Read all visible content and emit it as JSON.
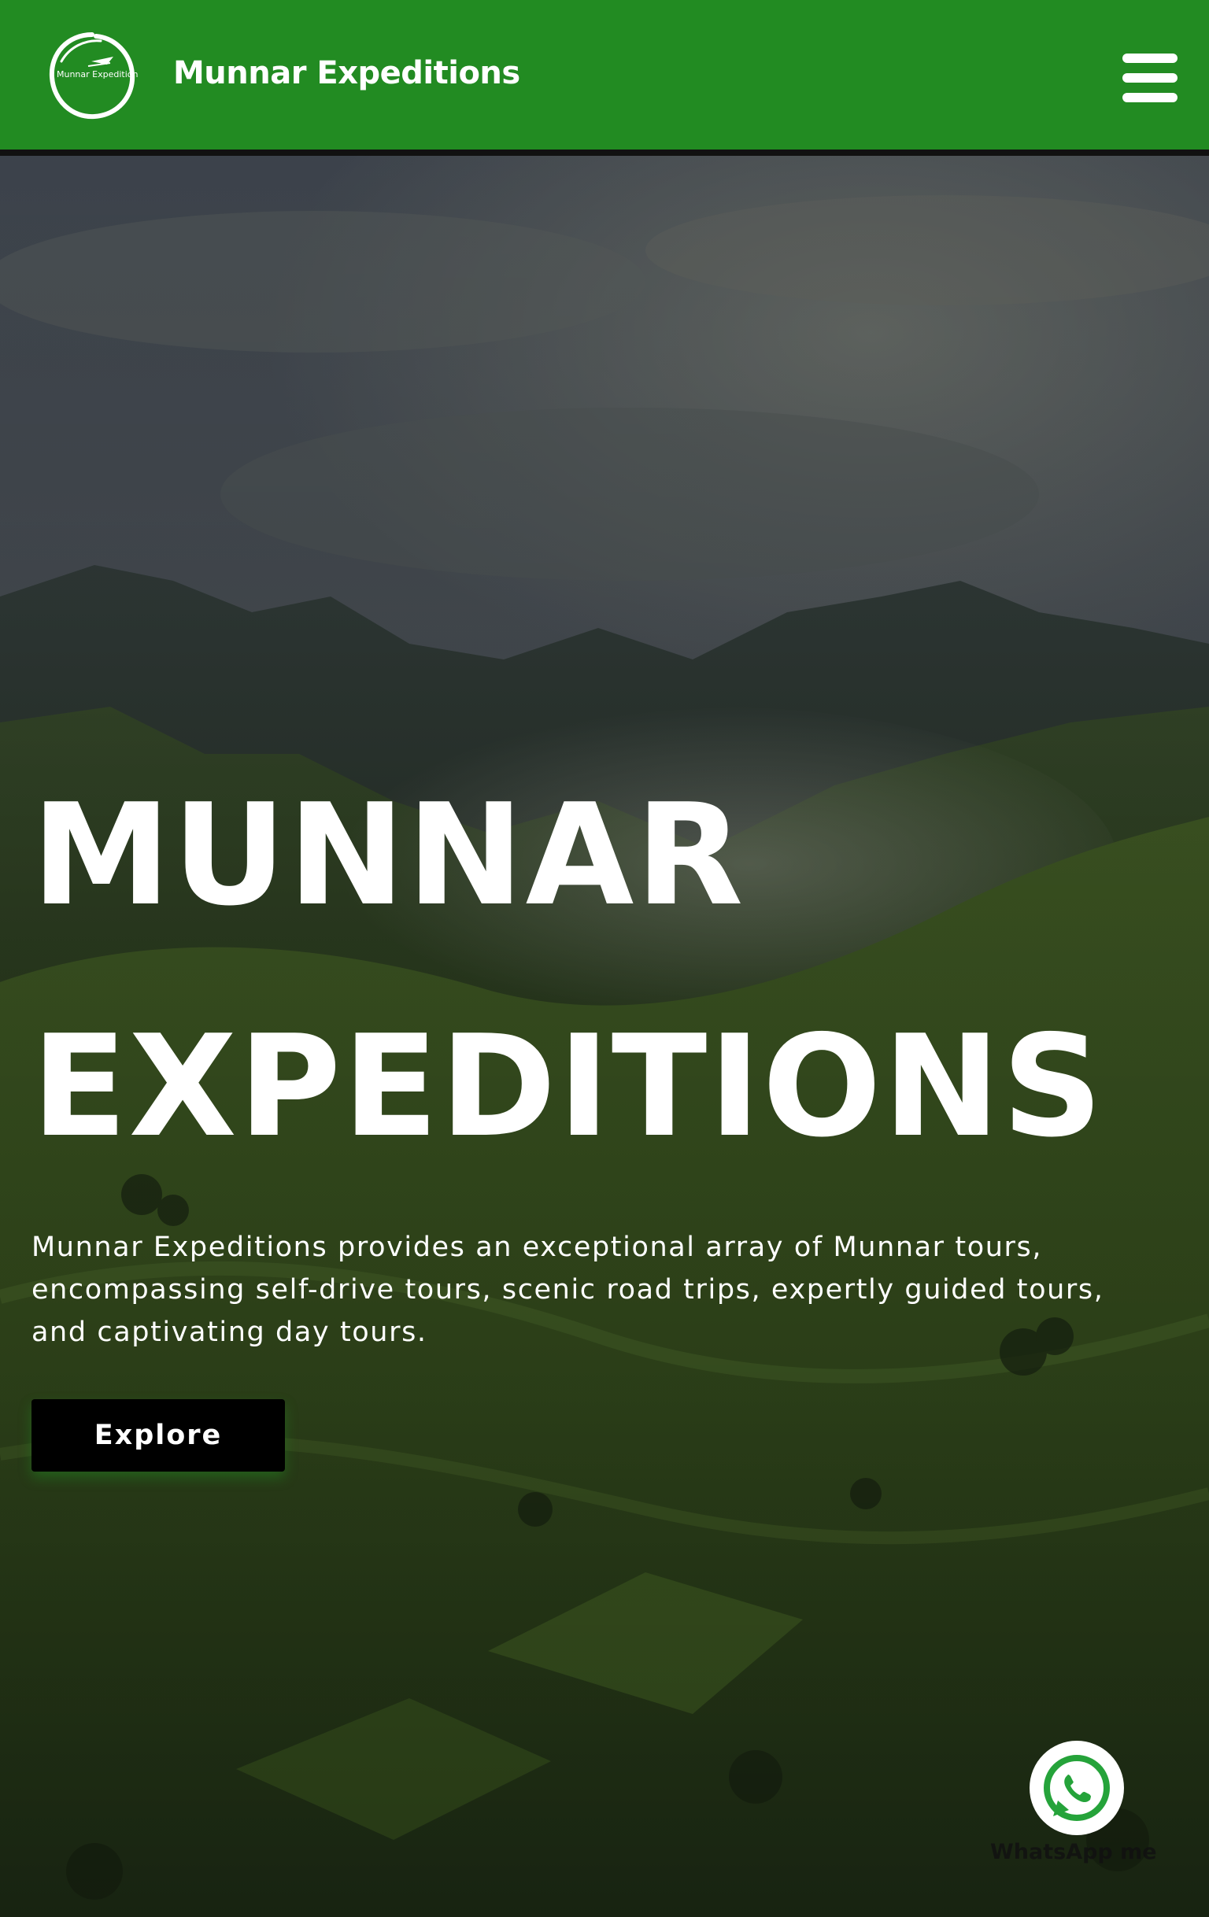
{
  "header": {
    "logo_text": "Munnar Expedition",
    "brand": "Munnar Expeditions",
    "menu_icon": "hamburger-icon",
    "bg_color": "#228b22"
  },
  "hero": {
    "title_line1": "MUNNAR",
    "title_line2": "EXPEDITIONS",
    "description": "Munnar Expeditions provides an exceptional array of Munnar tours, encompassing self-drive tours, scenic road trips, expertly guided tours, and captivating day tours.",
    "cta_label": "Explore",
    "background": "misty-green-hills-valley"
  },
  "whatsapp": {
    "icon": "whatsapp-icon",
    "label": "WhatsApp me"
  }
}
